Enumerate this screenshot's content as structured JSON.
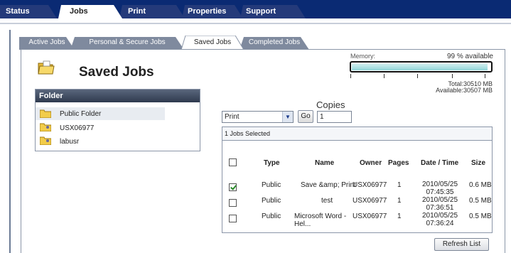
{
  "top_tabs": {
    "status": "Status",
    "jobs": "Jobs",
    "print": "Print",
    "properties": "Properties",
    "support": "Support"
  },
  "sub_tabs": {
    "active": "Active Jobs",
    "personal": "Personal & Secure Jobs",
    "saved": "Saved Jobs",
    "completed": "Completed Jobs"
  },
  "page_title": "Saved Jobs",
  "folder_panel": {
    "header": "Folder",
    "items": [
      {
        "label": "Public Folder",
        "icon": "folder-icon"
      },
      {
        "label": "USX06977",
        "icon": "user-folder-icon"
      },
      {
        "label": "labusr",
        "icon": "user-folder-icon"
      }
    ]
  },
  "memory": {
    "label": "Memory:",
    "available_text": "99 % available",
    "available_fraction": 0.99,
    "total": "Total:30510 MB",
    "available": "Available:30507 MB"
  },
  "controls": {
    "action_value": "Print",
    "go_label": "Go",
    "copies_label": "Copies",
    "copies_value": "1"
  },
  "jobs_table": {
    "selected_text": "1 Jobs Selected",
    "headers": {
      "type": "Type",
      "name": "Name",
      "owner": "Owner",
      "pages": "Pages",
      "datetime": "Date / Time",
      "size": "Size"
    },
    "rows": [
      {
        "checked": true,
        "type": "Public",
        "name": "Save &amp; Print",
        "owner": "USX06977",
        "pages": "1",
        "date": "2010/05/25",
        "time": "07:45:35",
        "size": "0.6 MB"
      },
      {
        "checked": false,
        "type": "Public",
        "name": "test",
        "owner": "USX06977",
        "pages": "1",
        "date": "2010/05/25",
        "time": "07:36:51",
        "size": "0.5 MB"
      },
      {
        "checked": false,
        "type": "Public",
        "name": "Microsoft Word - Hel...",
        "owner": "USX06977",
        "pages": "1",
        "date": "2010/05/25",
        "time": "07:36:24",
        "size": "0.5 MB"
      }
    ]
  },
  "refresh_label": "Refresh List",
  "colors": {
    "nav_bg": "#0a2a73",
    "tab_inactive": "#243a7a",
    "tab_active": "#ffffff",
    "memory_fill": "#8fd3d6"
  }
}
